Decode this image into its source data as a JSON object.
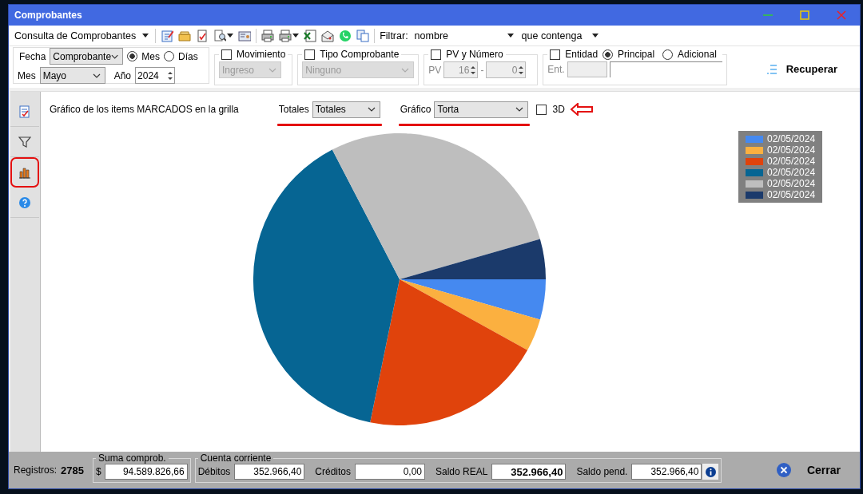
{
  "window": {
    "title": "Comprobantes"
  },
  "toolbar": {
    "query": "Consulta de Comprobantes",
    "filter_label": "Filtrar:",
    "filter_field": "nombre",
    "filter_mode": "que contenga"
  },
  "filters": {
    "fecha": {
      "label": "Fecha",
      "value": "Comprobante",
      "radios": [
        {
          "label": "Mes",
          "selected": true
        },
        {
          "label": "Días",
          "selected": false
        }
      ],
      "mes_label": "Mes",
      "mes": "Mayo",
      "anio_label": "Año",
      "anio": "2024"
    },
    "movimiento": {
      "label": "Movimiento",
      "checked": false,
      "value": "Ingreso"
    },
    "tipo": {
      "label": "Tipo Comprobante",
      "checked": false,
      "value": "Ninguno"
    },
    "pv": {
      "label": "PV y Número",
      "checked": false,
      "pv_label": "PV",
      "pv": "16",
      "separator": "-",
      "numero": "0"
    },
    "entidad": {
      "label": "Entidad",
      "checked": false,
      "radios": [
        {
          "label": "Principal",
          "selected": true
        },
        {
          "label": "Adicional",
          "selected": false
        }
      ],
      "ent_label": "Ent."
    },
    "recuperar": "Recuperar"
  },
  "sidebar": {
    "items": [
      {
        "kind": "report",
        "selected": false
      },
      {
        "kind": "filter",
        "selected": false
      },
      {
        "kind": "chart",
        "selected": true
      },
      {
        "kind": "help",
        "selected": false
      }
    ]
  },
  "chart_panel": {
    "caption": "Gráfico de los items MARCADOS en la grilla",
    "totales_label": "Totales",
    "totales": "Totales",
    "grafico_label": "Gráfico",
    "grafico": "Torta",
    "three_d": {
      "label": "3D",
      "checked": false
    },
    "legend": [
      {
        "label": "02/05/2024",
        "color": "#4589f0"
      },
      {
        "label": "02/05/2024",
        "color": "#fbb040"
      },
      {
        "label": "02/05/2024",
        "color": "#e0430c"
      },
      {
        "label": "02/05/2024",
        "color": "#066593"
      },
      {
        "label": "02/05/2024",
        "color": "#bebebe"
      },
      {
        "label": "02/05/2024",
        "color": "#1b3a6b"
      }
    ]
  },
  "footer": {
    "registros_label": "Registros:",
    "registros": "2785",
    "suma_title": "Suma comprob.",
    "currency": "$",
    "suma": "94.589.826,66",
    "cuenta_title": "Cuenta corriente",
    "debitos_label": "Débitos",
    "debitos": "352.966,40",
    "creditos_label": "Créditos",
    "creditos": "0,00",
    "saldo_real_label": "Saldo REAL",
    "saldo_real": "352.966,40",
    "saldo_pend_label": "Saldo pend.",
    "saldo_pend": "352.966,40",
    "cerrar": "Cerrar"
  }
}
